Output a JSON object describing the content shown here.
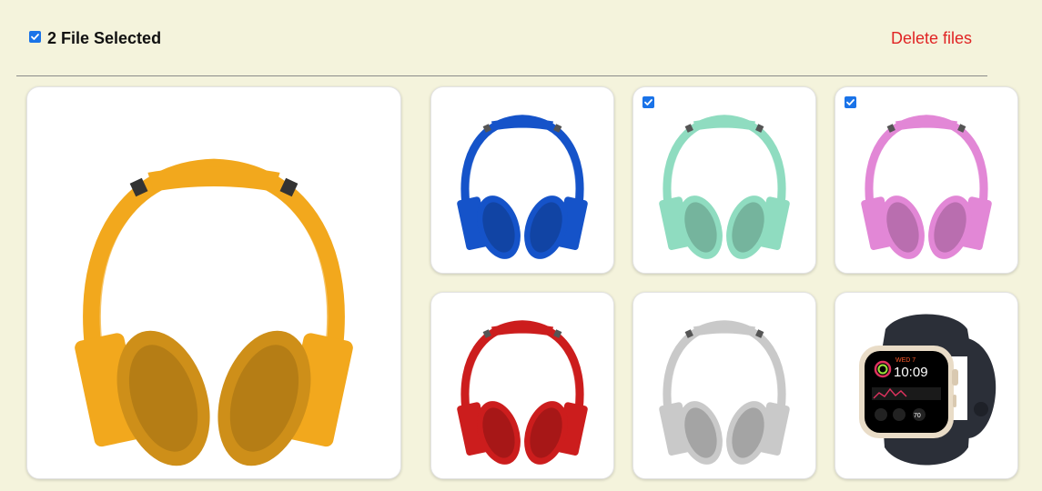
{
  "header": {
    "select_all_checked": true,
    "selected_label": "2 File Selected",
    "delete_label": "Delete files"
  },
  "gallery": {
    "featured": {
      "item": "headphones",
      "color": "#f2a81d",
      "selected": false
    },
    "tiles": [
      {
        "item": "headphones",
        "color": "#1553c9",
        "selected": false
      },
      {
        "item": "headphones",
        "color": "#8fdcc0",
        "selected": true
      },
      {
        "item": "headphones",
        "color": "#e287d6",
        "selected": true
      },
      {
        "item": "headphones",
        "color": "#cc1d1d",
        "selected": false
      },
      {
        "item": "headphones",
        "color": "#c9c9c9",
        "selected": false
      },
      {
        "item": "smartwatch",
        "color": "#2b2f38",
        "selected": false
      }
    ]
  },
  "watch_face": {
    "date": "WED 7",
    "time": "10:09",
    "complication": "70"
  },
  "colors": {
    "background": "#f4f3dc",
    "checkbox": "#1a73e8",
    "delete": "#e02424"
  }
}
